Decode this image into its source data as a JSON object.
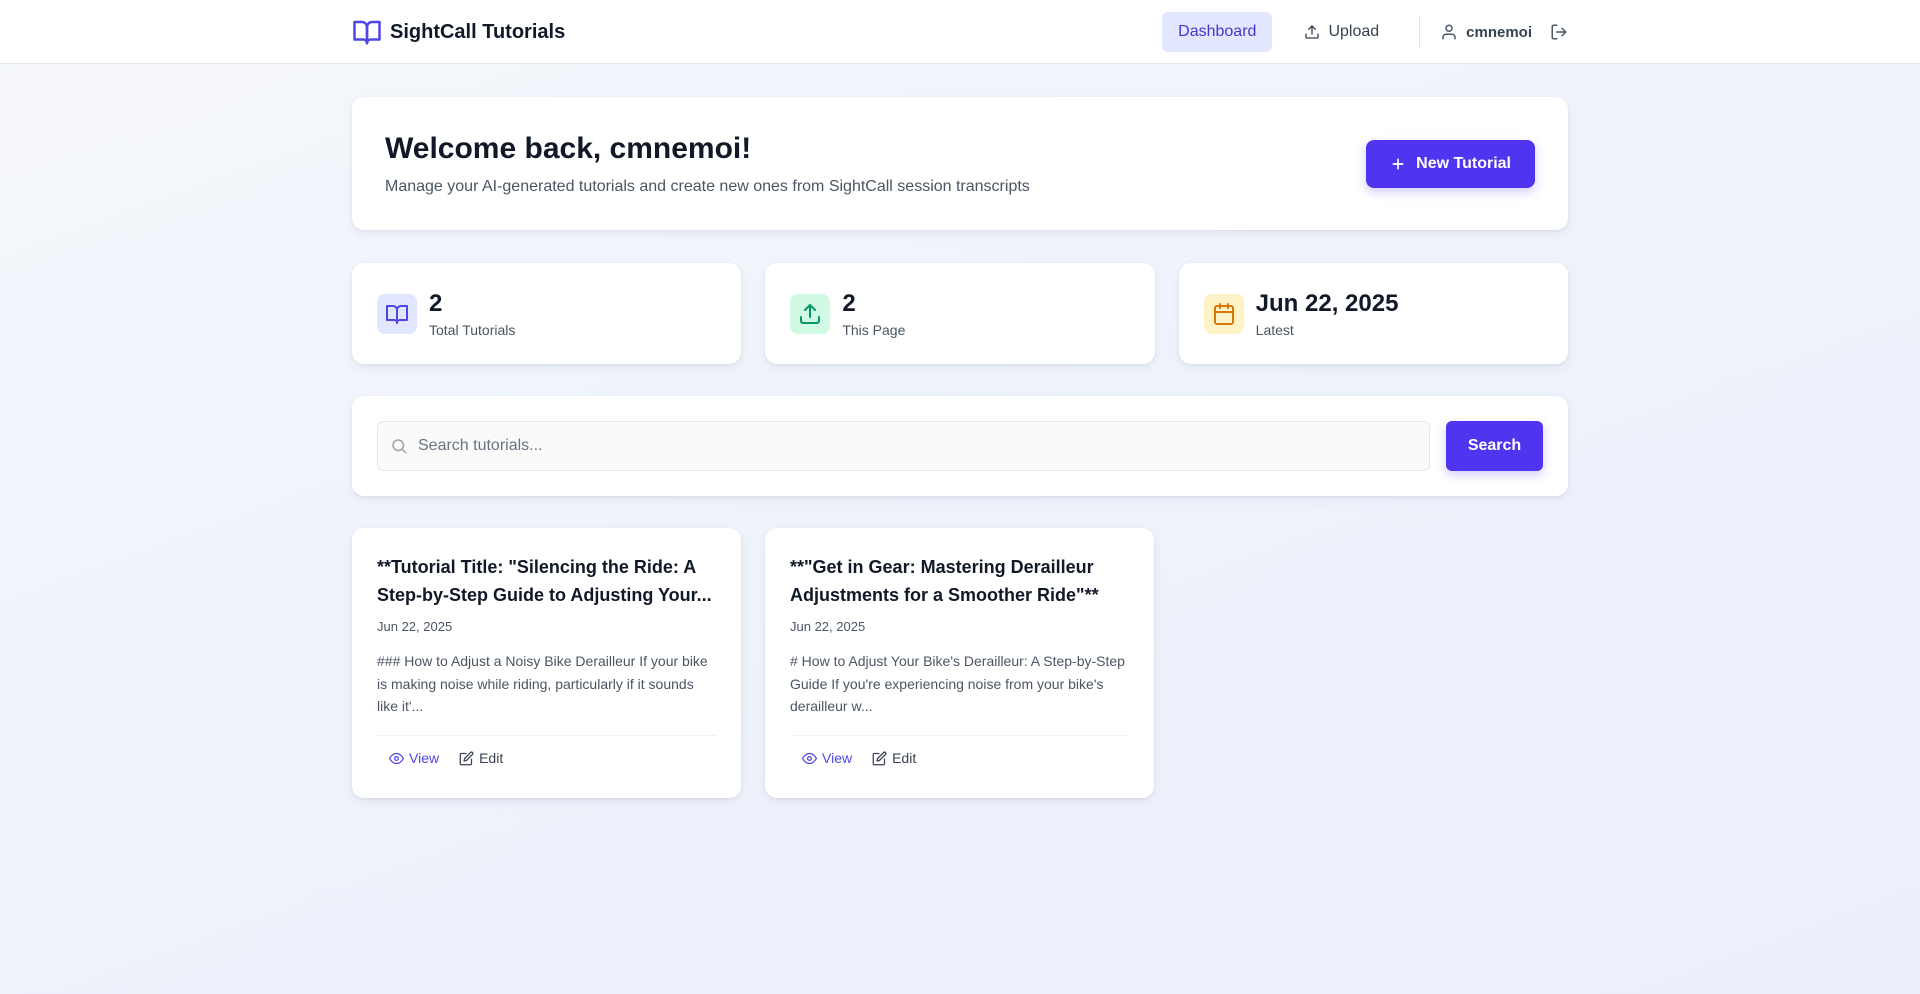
{
  "app": {
    "name": "SightCall Tutorials"
  },
  "nav": {
    "dashboard": "Dashboard",
    "upload": "Upload",
    "username": "cmnemoi"
  },
  "welcome": {
    "title": "Welcome back, cmnemoi!",
    "subtitle": "Manage your AI-generated tutorials and create new ones from SightCall session transcripts",
    "new_button": "New Tutorial"
  },
  "stats": [
    {
      "value": "2",
      "label": "Total Tutorials",
      "icon": "book-icon",
      "color": "#4f46e5"
    },
    {
      "value": "2",
      "label": "This Page",
      "icon": "upload-icon",
      "color": "#059669"
    },
    {
      "value": "Jun 22, 2025",
      "label": "Latest",
      "icon": "calendar-icon",
      "color": "#d97706"
    }
  ],
  "search": {
    "placeholder": "Search tutorials...",
    "button": "Search"
  },
  "tutorials": [
    {
      "title": "**Tutorial Title: \"Silencing the Ride: A Step-by-Step Guide to Adjusting Your...",
      "date": "Jun 22, 2025",
      "excerpt": "### How to Adjust a Noisy Bike Derailleur If your bike is making noise while riding, particularly if it sounds like it'...",
      "view": "View",
      "edit": "Edit"
    },
    {
      "title": "**\"Get in Gear: Mastering Derailleur Adjustments for a Smoother Ride\"**",
      "date": "Jun 22, 2025",
      "excerpt": "# How to Adjust Your Bike's Derailleur: A Step-by-Step Guide If you're experiencing noise from your bike's derailleur w...",
      "view": "View",
      "edit": "Edit"
    }
  ],
  "colors": {
    "accent": "#4f35ef",
    "nav_active_bg": "#e0e7ff"
  }
}
